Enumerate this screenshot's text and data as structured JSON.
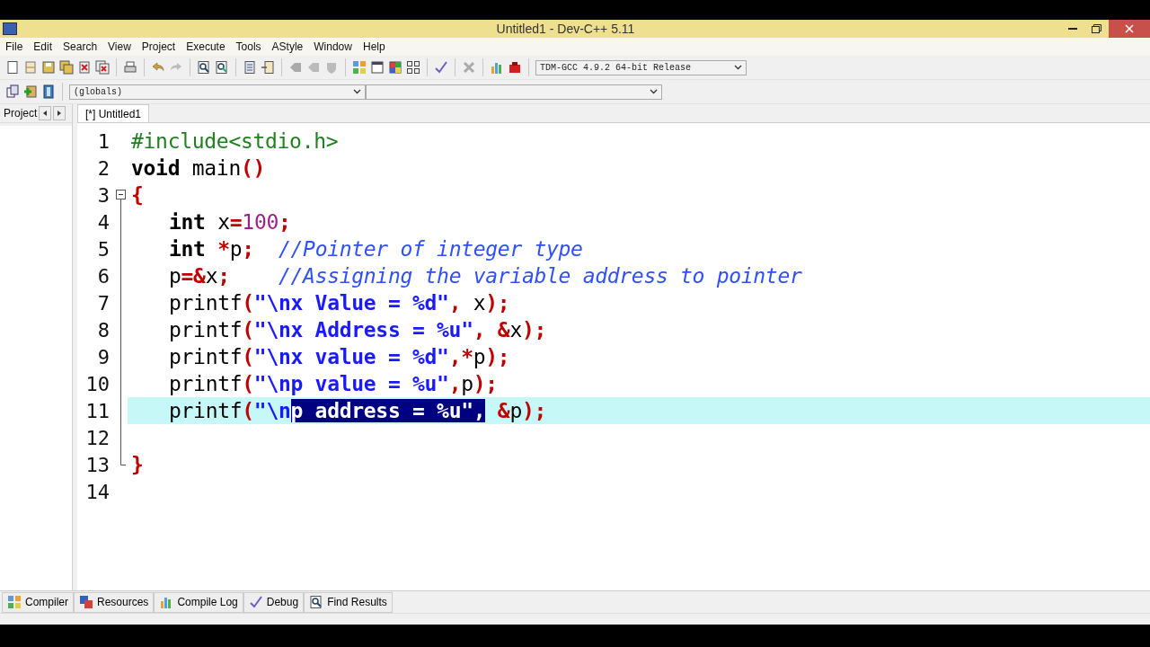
{
  "window": {
    "title": "Untitled1 - Dev-C++ 5.11"
  },
  "menu": [
    "File",
    "Edit",
    "Search",
    "View",
    "Project",
    "Execute",
    "Tools",
    "AStyle",
    "Window",
    "Help"
  ],
  "compiler_select": {
    "value": "TDM-GCC 4.9.2 64-bit Release"
  },
  "scope_select": {
    "value": "(globals)"
  },
  "left_panel": {
    "tab": "Project"
  },
  "editor_tabs": [
    {
      "label": "[*] Untitled1",
      "selected": true
    }
  ],
  "code_lines": [
    {
      "number": "1",
      "fold_start": false,
      "fold_end": false,
      "current": false,
      "indented": false,
      "tokens": [
        {
          "text": "#include<stdio.h>",
          "kind": "preprocessor",
          "selected": false
        }
      ]
    },
    {
      "number": "2",
      "fold_start": false,
      "fold_end": false,
      "current": false,
      "indented": false,
      "tokens": [
        {
          "text": "void",
          "kind": "keyword",
          "selected": false
        },
        {
          "text": " main",
          "kind": "plain",
          "selected": false
        },
        {
          "text": "()",
          "kind": "symbol",
          "selected": false
        }
      ]
    },
    {
      "number": "3",
      "fold_start": true,
      "fold_end": false,
      "current": false,
      "indented": false,
      "tokens": [
        {
          "text": "{",
          "kind": "symbol",
          "selected": false
        }
      ]
    },
    {
      "number": "4",
      "fold_start": false,
      "fold_end": false,
      "current": false,
      "indented": true,
      "tokens": [
        {
          "text": "int",
          "kind": "keyword",
          "selected": false
        },
        {
          "text": " x",
          "kind": "plain",
          "selected": false
        },
        {
          "text": "=",
          "kind": "symbol",
          "selected": false
        },
        {
          "text": "100",
          "kind": "number",
          "selected": false
        },
        {
          "text": ";",
          "kind": "symbol",
          "selected": false
        }
      ]
    },
    {
      "number": "5",
      "fold_start": false,
      "fold_end": false,
      "current": false,
      "indented": true,
      "tokens": [
        {
          "text": "int",
          "kind": "keyword",
          "selected": false
        },
        {
          "text": " *",
          "kind": "symbol",
          "selected": false
        },
        {
          "text": "p",
          "kind": "plain",
          "selected": false
        },
        {
          "text": ";",
          "kind": "symbol",
          "selected": false
        },
        {
          "text": "  //Pointer of integer type",
          "kind": "comment",
          "selected": false
        }
      ]
    },
    {
      "number": "6",
      "fold_start": false,
      "fold_end": false,
      "current": false,
      "indented": true,
      "tokens": [
        {
          "text": "p",
          "kind": "plain",
          "selected": false
        },
        {
          "text": "=&",
          "kind": "symbol",
          "selected": false
        },
        {
          "text": "x",
          "kind": "plain",
          "selected": false
        },
        {
          "text": ";",
          "kind": "symbol",
          "selected": false
        },
        {
          "text": "    //Assigning the variable address to pointer",
          "kind": "comment",
          "selected": false
        }
      ]
    },
    {
      "number": "7",
      "fold_start": false,
      "fold_end": false,
      "current": false,
      "indented": true,
      "tokens": [
        {
          "text": "printf",
          "kind": "plain",
          "selected": false
        },
        {
          "text": "(",
          "kind": "symbol",
          "selected": false
        },
        {
          "text": "\"\\nx Value = %d\"",
          "kind": "string",
          "selected": false
        },
        {
          "text": ",",
          "kind": "symbol",
          "selected": false
        },
        {
          "text": " x",
          "kind": "plain",
          "selected": false
        },
        {
          "text": ");",
          "kind": "symbol",
          "selected": false
        }
      ]
    },
    {
      "number": "8",
      "fold_start": false,
      "fold_end": false,
      "current": false,
      "indented": true,
      "tokens": [
        {
          "text": "printf",
          "kind": "plain",
          "selected": false
        },
        {
          "text": "(",
          "kind": "symbol",
          "selected": false
        },
        {
          "text": "\"\\nx Address = %u\"",
          "kind": "string",
          "selected": false
        },
        {
          "text": ", &",
          "kind": "symbol",
          "selected": false
        },
        {
          "text": "x",
          "kind": "plain",
          "selected": false
        },
        {
          "text": ");",
          "kind": "symbol",
          "selected": false
        }
      ]
    },
    {
      "number": "9",
      "fold_start": false,
      "fold_end": false,
      "current": false,
      "indented": true,
      "tokens": [
        {
          "text": "printf",
          "kind": "plain",
          "selected": false
        },
        {
          "text": "(",
          "kind": "symbol",
          "selected": false
        },
        {
          "text": "\"\\nx value = %d\"",
          "kind": "string",
          "selected": false
        },
        {
          "text": ",*",
          "kind": "symbol",
          "selected": false
        },
        {
          "text": "p",
          "kind": "plain",
          "selected": false
        },
        {
          "text": ");",
          "kind": "symbol",
          "selected": false
        }
      ]
    },
    {
      "number": "10",
      "fold_start": false,
      "fold_end": false,
      "current": false,
      "indented": true,
      "tokens": [
        {
          "text": "printf",
          "kind": "plain",
          "selected": false
        },
        {
          "text": "(",
          "kind": "symbol",
          "selected": false
        },
        {
          "text": "\"\\np value = %u\"",
          "kind": "string",
          "selected": false
        },
        {
          "text": ",",
          "kind": "symbol",
          "selected": false
        },
        {
          "text": "p",
          "kind": "plain",
          "selected": false
        },
        {
          "text": ");",
          "kind": "symbol",
          "selected": false
        }
      ]
    },
    {
      "number": "11",
      "fold_start": false,
      "fold_end": false,
      "current": true,
      "indented": true,
      "tokens": [
        {
          "text": "printf",
          "kind": "plain",
          "selected": false
        },
        {
          "text": "(",
          "kind": "symbol",
          "selected": false
        },
        {
          "text": "\"\\n",
          "kind": "string",
          "selected": false
        },
        {
          "text": "p address = %u\",",
          "kind": "string",
          "selected": true
        },
        {
          "text": " &",
          "kind": "symbol",
          "selected": false
        },
        {
          "text": "p",
          "kind": "plain",
          "selected": false
        },
        {
          "text": ");",
          "kind": "symbol",
          "selected": false
        }
      ]
    },
    {
      "number": "12",
      "fold_start": false,
      "fold_end": false,
      "current": false
    },
    {
      "number": "13",
      "fold_start": false,
      "fold_end": true,
      "current": false,
      "indented": false,
      "tokens": [
        {
          "text": "}",
          "kind": "symbol",
          "selected": false
        }
      ]
    },
    {
      "number": "14",
      "fold_start": false,
      "fold_end": false,
      "current": false
    }
  ],
  "bottom_tabs": [
    {
      "label": "Compiler"
    },
    {
      "label": "Resources"
    },
    {
      "label": "Compile Log"
    },
    {
      "label": "Debug"
    },
    {
      "label": "Find Results"
    }
  ]
}
